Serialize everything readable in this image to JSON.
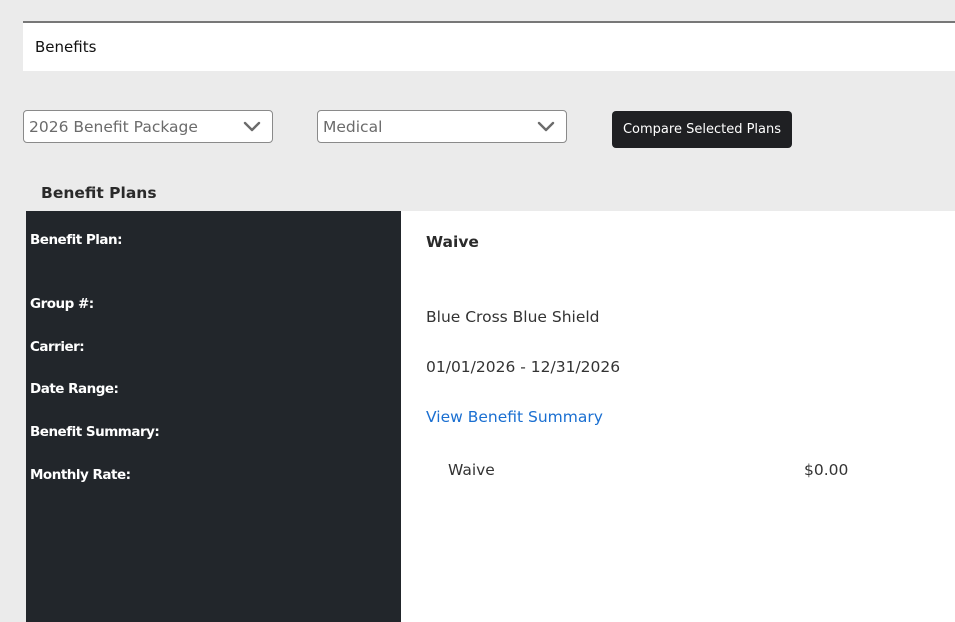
{
  "header": {
    "title": "Benefits"
  },
  "filters": {
    "package_selected": "2026 Benefit Package",
    "category_selected": "Medical",
    "chevron_icon": "chevron-down-icon"
  },
  "actions": {
    "compare_label": "Compare Selected Plans"
  },
  "section": {
    "title": "Benefit Plans"
  },
  "labels": {
    "benefit_plan": "Benefit Plan:",
    "group_number": "Group #:",
    "carrier": "Carrier:",
    "date_range": "Date Range:",
    "benefit_summary": "Benefit Summary:",
    "monthly_rate": "Monthly Rate:"
  },
  "plan": {
    "name": "Waive",
    "group_number": "",
    "carrier": "Blue Cross Blue Shield",
    "date_range": "01/01/2026 - 12/31/2026",
    "summary_link": "View Benefit Summary",
    "rates": [
      {
        "tier": "Waive",
        "amount": "$0.00"
      }
    ]
  },
  "colors": {
    "page_bg": "#ebebeb",
    "label_panel": "#22262b",
    "button": "#1f2023",
    "link": "#1a6fd1"
  }
}
